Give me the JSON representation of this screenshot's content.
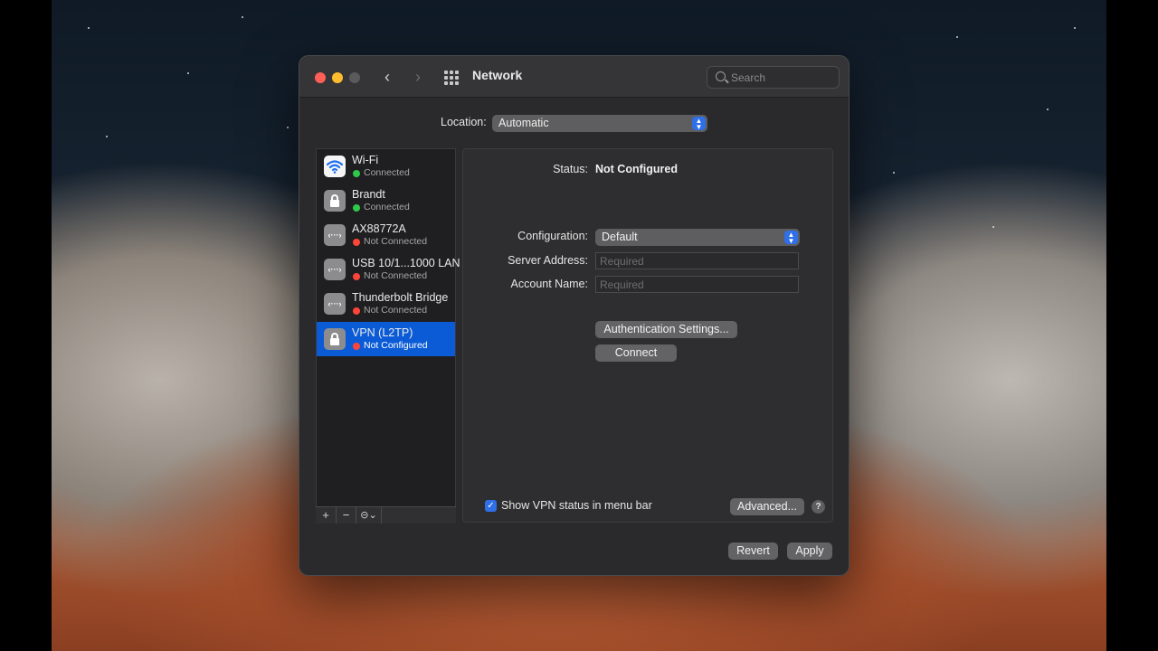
{
  "window": {
    "title": "Network",
    "search_placeholder": "Search"
  },
  "location": {
    "label": "Location:",
    "value": "Automatic"
  },
  "services": [
    {
      "name": "Wi-Fi",
      "status": "Connected",
      "status_color": "#2fc94a",
      "icon": "wifi-icon"
    },
    {
      "name": "Brandt",
      "status": "Connected",
      "status_color": "#2fc94a",
      "icon": "lock-icon"
    },
    {
      "name": "AX88772A",
      "status": "Not Connected",
      "status_color": "#ff453a",
      "icon": "ethernet-icon"
    },
    {
      "name": "USB 10/1...1000 LAN",
      "status": "Not Connected",
      "status_color": "#ff453a",
      "icon": "ethernet-icon"
    },
    {
      "name": "Thunderbolt Bridge",
      "status": "Not Connected",
      "status_color": "#ff453a",
      "icon": "ethernet-icon"
    },
    {
      "name": "VPN (L2TP)",
      "status": "Not Configured",
      "status_color": "#ff453a",
      "icon": "lock-icon",
      "selected": true
    }
  ],
  "sidebar_toolbar": {
    "add": "+",
    "remove": "−",
    "action": "⊝⌄"
  },
  "detail": {
    "status_label": "Status:",
    "status_value": "Not Configured",
    "configuration_label": "Configuration:",
    "configuration_value": "Default",
    "server_label": "Server Address:",
    "server_placeholder": "Required",
    "account_label": "Account Name:",
    "account_placeholder": "Required",
    "auth_button": "Authentication Settings...",
    "connect_button": "Connect",
    "show_vpn_label": "Show VPN status in menu bar",
    "show_vpn_checked": true,
    "advanced_button": "Advanced...",
    "help": "?"
  },
  "footer": {
    "revert": "Revert",
    "apply": "Apply"
  },
  "colors": {
    "accent": "#2f6fe8",
    "selection": "#0b5bd6"
  }
}
